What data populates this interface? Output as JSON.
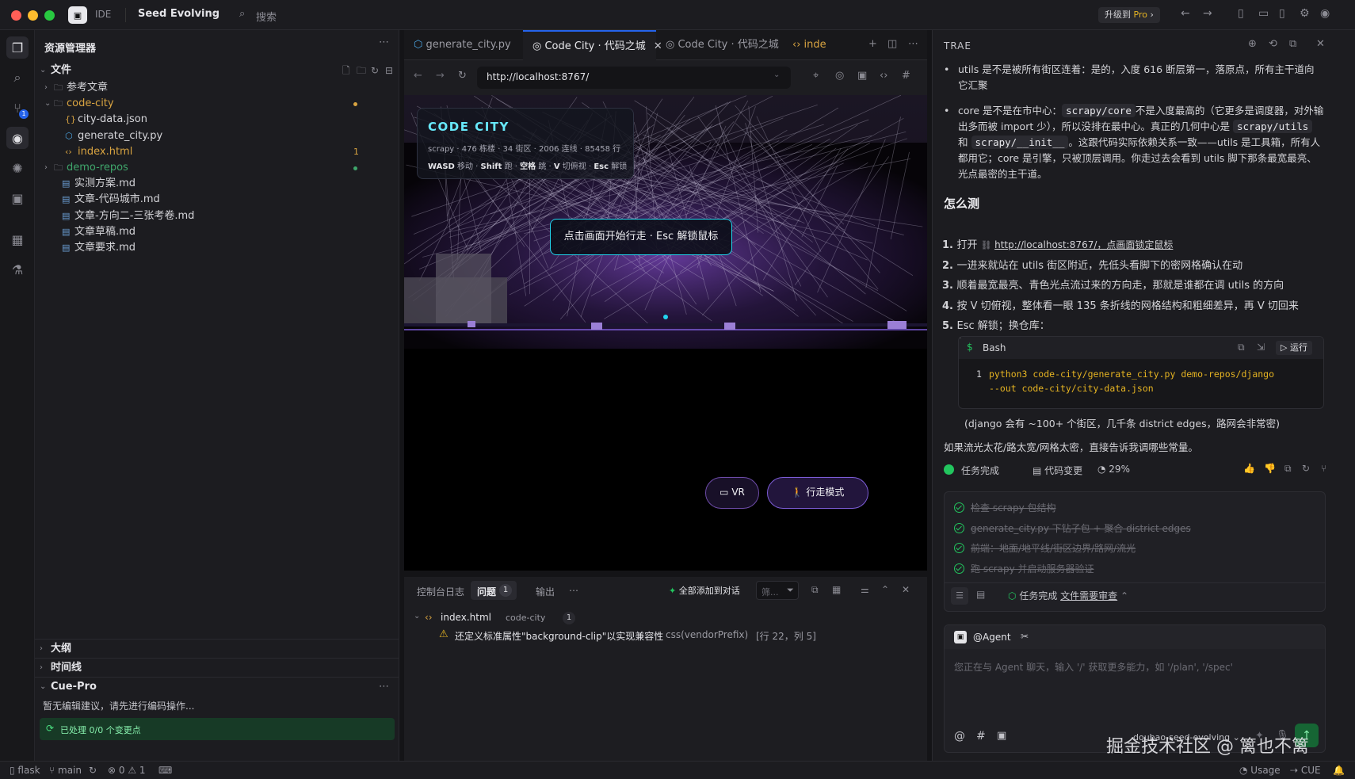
{
  "titlebar": {
    "ide_label": "IDE",
    "project": "Seed Evolving",
    "search": "搜索",
    "upgrade": "升级到",
    "pro": "Pro"
  },
  "explorer": {
    "title": "资源管理器",
    "section": "文件",
    "items": [
      {
        "label": "参考文章",
        "type": "folder",
        "collapsed": true
      },
      {
        "label": "code-city",
        "type": "folder",
        "collapsed": false,
        "color": "#d9a441"
      },
      {
        "label": "city-data.json",
        "type": "json"
      },
      {
        "label": "generate_city.py",
        "type": "py"
      },
      {
        "label": "index.html",
        "type": "html",
        "badge": "1",
        "color": "#d9a441"
      },
      {
        "label": "demo-repos",
        "type": "folder",
        "collapsed": true,
        "color": "#3fa66b"
      },
      {
        "label": "实测方案.md",
        "type": "md"
      },
      {
        "label": "文章-代码城市.md",
        "type": "md"
      },
      {
        "label": "文章-方向二-三张考卷.md",
        "type": "md"
      },
      {
        "label": "文章草稿.md",
        "type": "md"
      },
      {
        "label": "文章要求.md",
        "type": "md"
      }
    ],
    "outline": "大纲",
    "timeline": "时间线",
    "cue_title": "Cue-Pro",
    "cue_empty": "暂无编辑建议，请先进行编码操作...",
    "cue_status": "已处理 0/0 个变更点"
  },
  "editor": {
    "tabs": [
      "generate_city.py",
      "Code City · 代码之城",
      "Code City · 代码之城",
      "inde"
    ],
    "url": "http://localhost:8767/"
  },
  "scene": {
    "title": "CODE CITY",
    "stats": "scrapy · 476 栋楼 · 34 街区 · 2006 连线 · 85458 行",
    "controls": [
      {
        "k": "WASD",
        "v": "移动"
      },
      {
        "k": "Shift",
        "v": "跑"
      },
      {
        "k": "空格",
        "v": "跳"
      },
      {
        "k": "V",
        "v": "切俯视"
      },
      {
        "k": "Esc",
        "v": "解锁"
      }
    ],
    "start_prompt": "点击画面开始行走 · Esc 解锁鼠标",
    "vr_button": "VR",
    "walk_button": "行走模式"
  },
  "panel": {
    "tabs": [
      "控制台日志",
      "问题",
      "输出"
    ],
    "problem_count": "1",
    "add_all": "全部添加到对话",
    "filter_placeholder": "筛...",
    "file": "index.html",
    "folder": "code-city",
    "file_count": "1",
    "issue": "还定义标准属性\"background-clip\"以实现兼容性",
    "issue_source": "css(vendorPrefix)",
    "issue_loc": "[行 22，列 5]"
  },
  "trae": {
    "title": "TRAE",
    "bullet1_a": "utils 是不是被所有街区连着：是的，入度 616 断层第一，落原点，所有主干道向它汇聚",
    "bullet2_a": "core 是不是在市中心：",
    "bullet2_code1": "scrapy/core",
    "bullet2_b": "不是入度最高的（它更多是调度器，对外输出多而被 import 少），所以没排在最中心。真正的几何中心是",
    "bullet2_code2": "scrapy/utils",
    "bullet2_c": "和",
    "bullet2_code3": "scrapy/__init__",
    "bullet2_d": "。这跟代码实际依赖关系一致——utils 是工具箱，所有人都用它；core 是引擎，只被顶层调用。你走过去会看到 utils 脚下那条最宽最亮、光点最密的主干道。",
    "heading": "怎么测",
    "steps": [
      {
        "n": "1.",
        "pre": "打开",
        "link": "http://localhost:8767/，点画面锁定鼠标"
      },
      {
        "n": "2.",
        "pre": "一进来就站在 utils 街区附近，先低头看脚下的密网格确认在动",
        "link": ""
      },
      {
        "n": "3.",
        "pre": "顺着最宽最亮、青色光点流过来的方向走，那就是谁都在调 utils 的方向",
        "link": ""
      },
      {
        "n": "4.",
        "pre": "按 V 切俯视，整体看一眼 135 条折线的网格结构和粗细差异，再 V 切回来",
        "link": ""
      },
      {
        "n": "5.",
        "pre": "Esc 解锁；换仓库：",
        "link": ""
      }
    ],
    "bash_label": "Bash",
    "run_label": "运行",
    "code_line_no": "1",
    "code_line1": "python3 code-city/generate_city.py demo-repos/django",
    "code_line2": "--out code-city/city-data.json",
    "after_code": "(django 会有 ~100+ 个街区，几千条 district edges，路网会非常密)",
    "closing": "如果流光太花/路太宽/网格太密，直接告诉我调哪些常量。",
    "status_done": "任务完成",
    "status_changes": "代码变更",
    "status_pct": "29%",
    "todos": [
      "检查 scrapy 包结构",
      "generate_city.py 下钻子包 + 聚合 district edges",
      "前端：地面/地平线/街区边界/路网/流光",
      "跑 scrapy 并启动服务器验证"
    ],
    "todo_footer_done": "任务完成",
    "todo_footer_review": "文件需要审查",
    "agent": "@Agent",
    "input_placeholder": "您正在与 Agent 聊天，输入 '/' 获取更多能力，如 '/plan', '/spec'",
    "model": "doubao-seed-evolving"
  },
  "status": {
    "workspace": "flask",
    "branch": "main",
    "errors": "0",
    "warnings": "1",
    "usage": "Usage",
    "cue": "CUE"
  },
  "watermark": "掘金技术社区 @ 篱也不篱",
  "colors": {
    "accent": "#22d3ee",
    "folder": "#d9a441",
    "green": "#22c55e",
    "purple": "#8b5cf6"
  }
}
